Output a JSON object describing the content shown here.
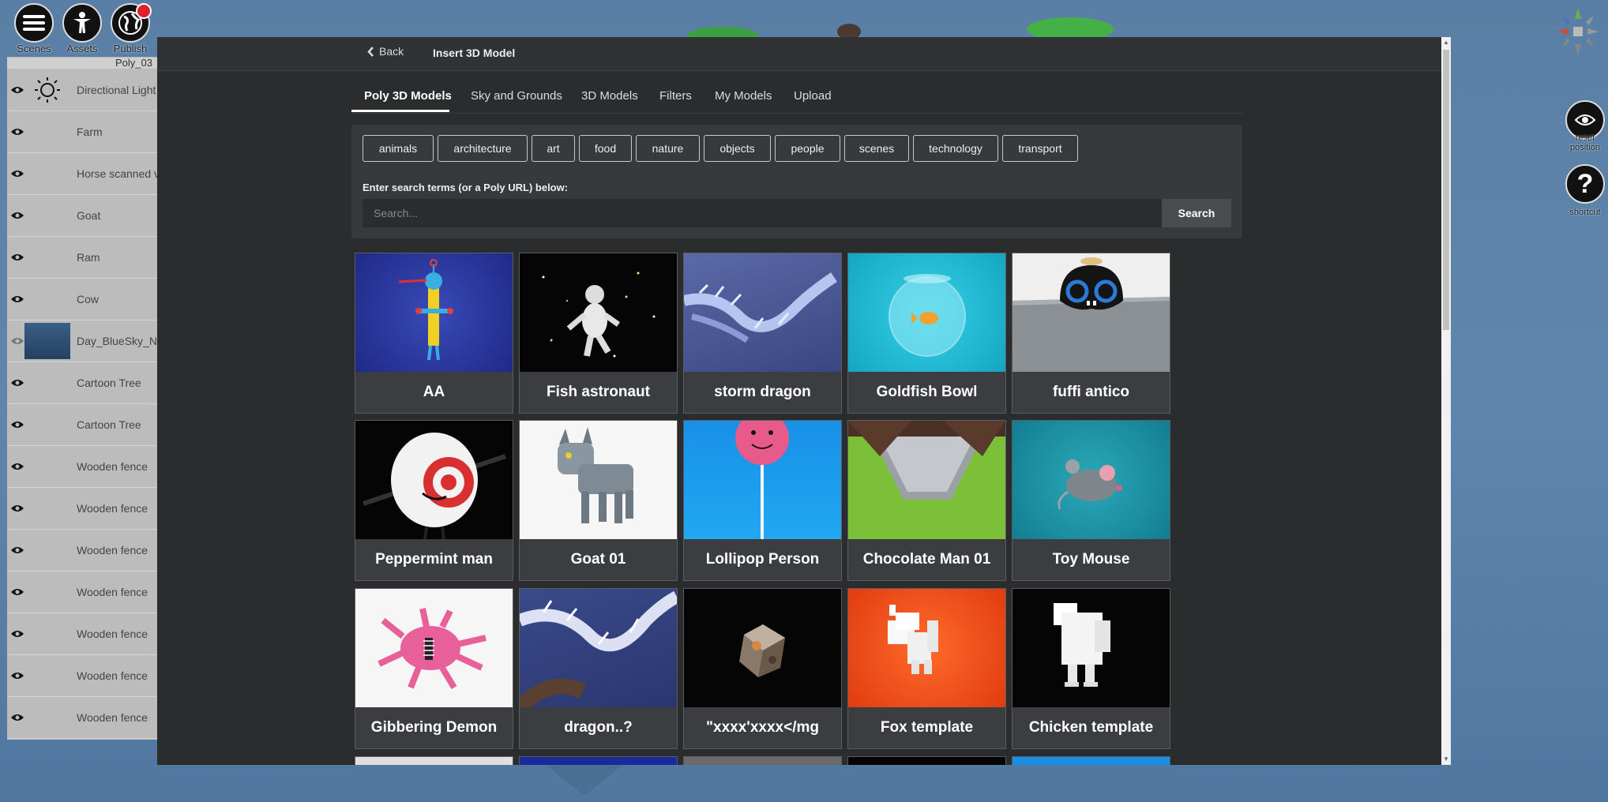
{
  "toolbar": {
    "items": [
      {
        "label": "Scenes",
        "icon": "menu-icon"
      },
      {
        "label": "Assets",
        "icon": "person-icon"
      },
      {
        "label": "Publish",
        "icon": "globe-icon"
      }
    ]
  },
  "hierarchy": {
    "title": "Poly_03",
    "items": [
      {
        "label": "Directional Light",
        "thumb": "light-bulb-icon"
      },
      {
        "label": "Farm",
        "thumb": ""
      },
      {
        "label": "Horse scanned v",
        "thumb": ""
      },
      {
        "label": "Goat",
        "thumb": ""
      },
      {
        "label": "Ram",
        "thumb": ""
      },
      {
        "label": "Cow",
        "thumb": ""
      },
      {
        "label": "Day_BlueSky_N",
        "thumb": "sky-thumbnail"
      },
      {
        "label": "Cartoon Tree",
        "thumb": ""
      },
      {
        "label": "Cartoon Tree",
        "thumb": ""
      },
      {
        "label": "Wooden fence",
        "thumb": ""
      },
      {
        "label": "Wooden fence",
        "thumb": ""
      },
      {
        "label": "Wooden fence",
        "thumb": ""
      },
      {
        "label": "Wooden fence",
        "thumb": ""
      },
      {
        "label": "Wooden fence",
        "thumb": ""
      },
      {
        "label": "Wooden fence",
        "thumb": ""
      },
      {
        "label": "Wooden fence",
        "thumb": ""
      }
    ]
  },
  "right_tools": [
    {
      "label1": "reset",
      "label2": "position",
      "icon": "eye-icon"
    },
    {
      "label1": "shortcut",
      "label2": "",
      "icon": "question-icon"
    }
  ],
  "modal": {
    "back_label": "Back",
    "title": "Insert 3D Model",
    "tabs": [
      "Poly 3D Models",
      "Sky and Grounds",
      "3D Models",
      "Filters",
      "My Models",
      "Upload"
    ],
    "active_tab": "Poly 3D Models",
    "categories": [
      "animals",
      "architecture",
      "art",
      "food",
      "nature",
      "objects",
      "people",
      "scenes",
      "technology",
      "transport"
    ],
    "search_label": "Enter search terms (or a Poly URL) below:",
    "search_placeholder": "Search...",
    "search_value": "",
    "search_button": "Search",
    "models": [
      {
        "title": "AA",
        "bg": "#2a3a9c"
      },
      {
        "title": "Fish astronaut",
        "bg": "#050505"
      },
      {
        "title": "storm dragon",
        "bg": "#4a5690"
      },
      {
        "title": "Goldfish Bowl",
        "bg": "#20b8d0"
      },
      {
        "title": "fuffi antico",
        "bg": "#e8e8e8"
      },
      {
        "title": "Peppermint man",
        "bg": "#050505"
      },
      {
        "title": "Goat 01",
        "bg": "#f4f4f4"
      },
      {
        "title": "Lollipop Person",
        "bg": "#1a9ae8"
      },
      {
        "title": "Chocolate Man 01",
        "bg": "#7cc03a"
      },
      {
        "title": "Toy Mouse",
        "bg": "#1e96a8"
      },
      {
        "title": "Gibbering Demon",
        "bg": "#f6f6f6"
      },
      {
        "title": "dragon..?",
        "bg": "#3a4a8a"
      },
      {
        "title": "\"xxxx'xxxx</mg",
        "bg": "#050505"
      },
      {
        "title": "Fox template",
        "bg": "#f04a18"
      },
      {
        "title": "Chicken template",
        "bg": "#050505"
      }
    ]
  }
}
